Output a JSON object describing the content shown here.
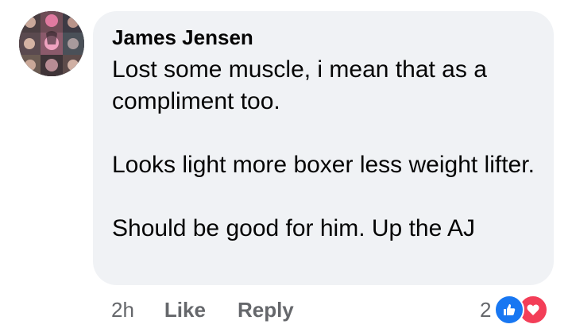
{
  "comment": {
    "author": "James Jensen",
    "paragraphs": [
      "Lost some muscle, i mean that as a compliment too.",
      "Looks light more boxer less weight lifter.",
      "Should be good for him. Up the AJ"
    ],
    "avatar_icon": "profile-photo-collage"
  },
  "actions": {
    "timestamp": "2h",
    "like_label": "Like",
    "reply_label": "Reply"
  },
  "reactions": {
    "count": "2",
    "types": [
      "like",
      "love"
    ],
    "like_color": "#1877f2",
    "love_color": "#f33e58"
  },
  "colors": {
    "bubble": "#f0f2f5",
    "text": "#050505",
    "secondary_text": "#65676b"
  }
}
